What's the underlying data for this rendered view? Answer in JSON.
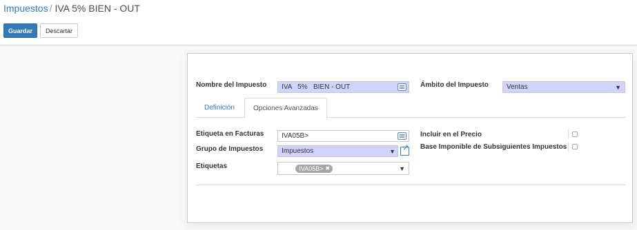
{
  "breadcrumb": {
    "parent": "Impuestos",
    "separator": "/",
    "current": "IVA 5% BIEN - OUT"
  },
  "buttons": {
    "save": "Guardar",
    "discard": "Descartar"
  },
  "form": {
    "tax_name_label": "Nombre del Impuesto",
    "tax_name_value": "IVA   5%   BIEN - OUT",
    "scope_label": "Ámbito del Impuesto",
    "scope_value": "Ventas"
  },
  "tabs": [
    "Definición",
    "Opciones Avanzadas"
  ],
  "advanced": {
    "invoice_label": "Etiqueta en Facturas",
    "invoice_value": "IVA05B>",
    "group_label": "Grupo de Impuestos",
    "group_value": "Impuestos",
    "tags_label": "Etiquetas",
    "tag_value": "IVA05B>",
    "tag_remove": "✖",
    "include_price_label": "Incluir en el Precio",
    "include_price_checked": false,
    "base_label": "Base Imponible de Subsiguientes Impuestos",
    "base_checked": false
  },
  "colors": {
    "primary": "#337ab7",
    "required_field": "#d2d2ff",
    "tag": "#a5a5a5"
  },
  "icons": {
    "dropdown": "caret-down-icon",
    "translate": "translate-icon",
    "external": "external-link-icon",
    "remove": "remove-tag-icon"
  }
}
